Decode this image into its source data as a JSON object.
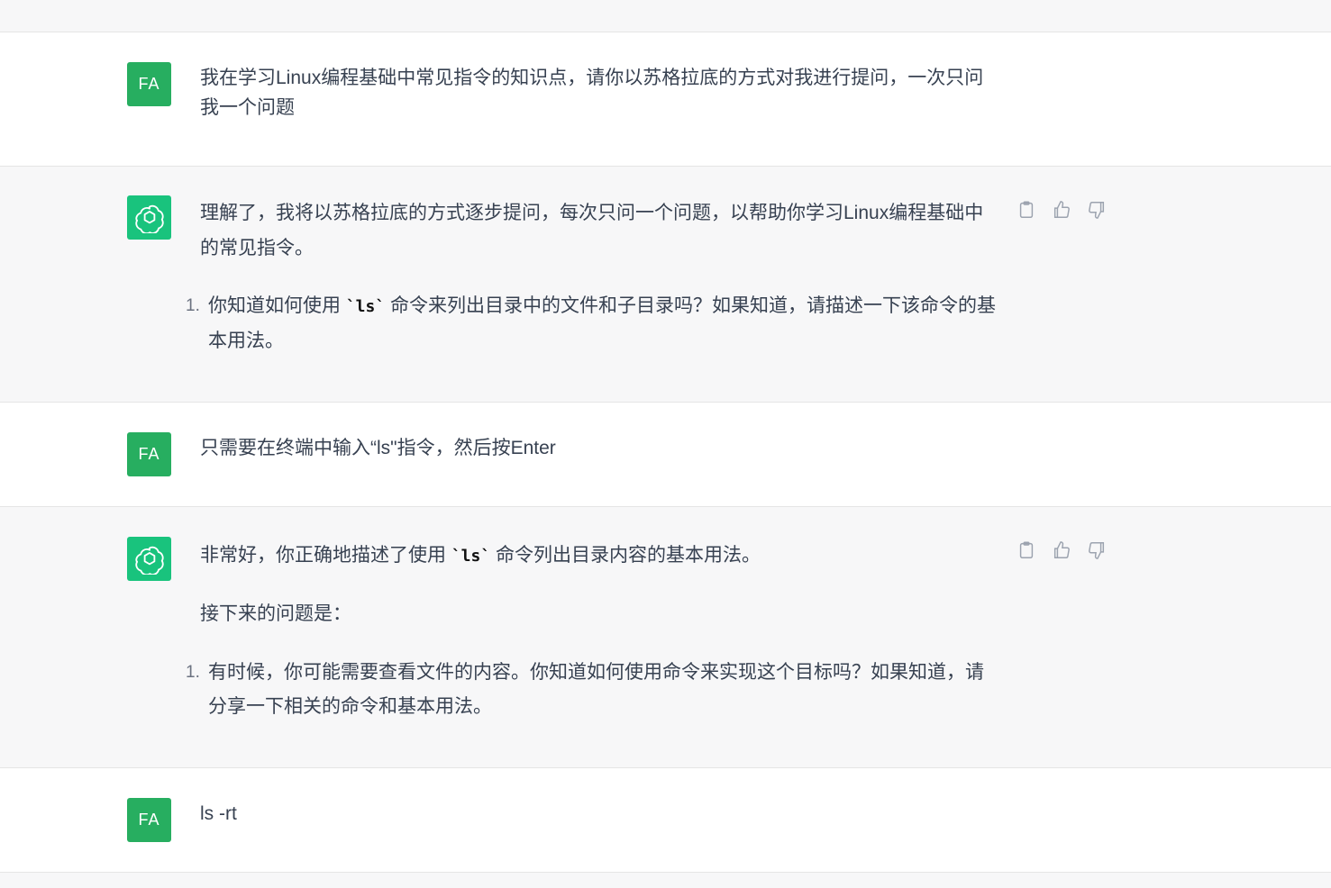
{
  "messages": [
    {
      "role": "user",
      "avatar": "FA",
      "text": "我在学习Linux编程基础中常见指令的知识点，请你以苏格拉底的方式对我进行提问，一次只问我一个问题"
    },
    {
      "role": "assistant",
      "intro": "理解了，我将以苏格拉底的方式逐步提问，每次只问一个问题，以帮助你学习Linux编程基础中的常见指令。",
      "list": [
        {
          "num": "1.",
          "before": "你知道如何使用 ",
          "code": "`ls`",
          "after": " 命令来列出目录中的文件和子目录吗？如果知道，请描述一下该命令的基本用法。"
        }
      ]
    },
    {
      "role": "user",
      "avatar": "FA",
      "text": "只需要在终端中输入“ls\"指令，然后按Enter"
    },
    {
      "role": "assistant",
      "intro_before": "非常好，你正确地描述了使用 ",
      "intro_code": "`ls`",
      "intro_after": " 命令列出目录内容的基本用法。",
      "para": "接下来的问题是：",
      "list": [
        {
          "num": "1.",
          "text": "有时候，你可能需要查看文件的内容。你知道如何使用命令来实现这个目标吗？如果知道，请分享一下相关的命令和基本用法。"
        }
      ]
    },
    {
      "role": "user",
      "avatar": "FA",
      "text": "ls -rt"
    }
  ],
  "icons": {
    "copy": "clipboard-icon",
    "like": "thumbs-up-icon",
    "dislike": "thumbs-down-icon",
    "assistant_avatar": "openai-logo-icon"
  },
  "colors": {
    "user_avatar": "#27ae60",
    "assistant_avatar": "#19c37d",
    "assistant_bg": "#f7f7f8",
    "text": "#374151"
  }
}
